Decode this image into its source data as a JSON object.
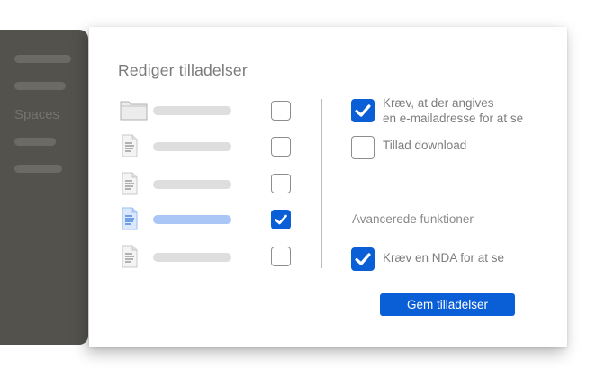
{
  "sidebar": {
    "label": "Spaces"
  },
  "dialog": {
    "title": "Rediger tilladelser",
    "files": [
      {
        "icon": "folder-icon",
        "selected": false,
        "checked": false
      },
      {
        "icon": "document-icon",
        "selected": false,
        "checked": false
      },
      {
        "icon": "document-icon",
        "selected": false,
        "checked": false
      },
      {
        "icon": "document-icon",
        "selected": true,
        "checked": true
      },
      {
        "icon": "document-icon",
        "selected": false,
        "checked": false
      }
    ],
    "options": {
      "require_email": {
        "line1": "Kræv, at der angives",
        "line2": "en e-mailadresse for at se",
        "checked": true
      },
      "allow_download": {
        "label": "Tillad download",
        "checked": false
      }
    },
    "advanced": {
      "heading": "Avancerede funktioner",
      "require_nda": {
        "label": "Kræv en NDA for at se",
        "checked": true
      }
    },
    "save_button": "Gem tilladelser"
  },
  "colors": {
    "accent": "#0a5fd6",
    "selected_bar": "#a9c6f7",
    "sidebar": "#54524d"
  }
}
